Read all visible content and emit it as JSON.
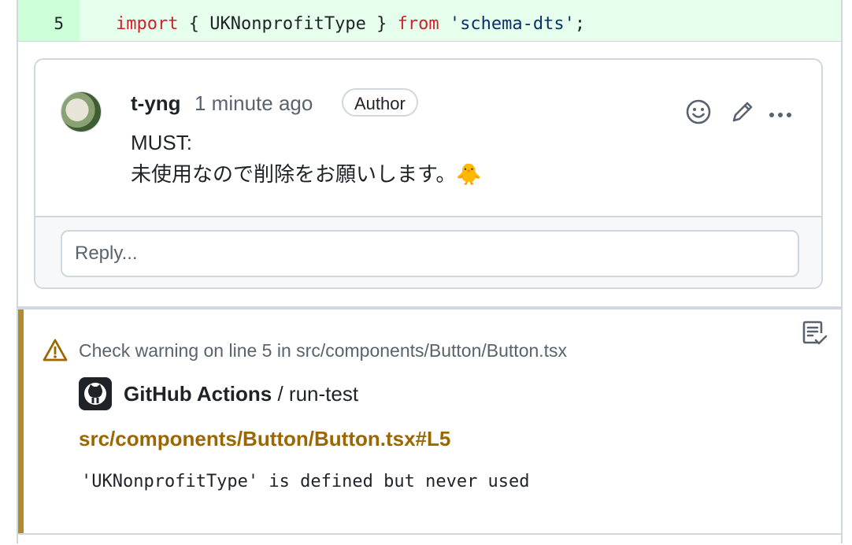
{
  "diff": {
    "line_number": "5",
    "code_keyword_import": "import",
    "code_middle": " { UKNonprofitType } ",
    "code_keyword_from": "from",
    "code_space": " ",
    "code_string": "'schema-dts'",
    "code_end": ";"
  },
  "comment": {
    "author": "t-yng",
    "time": "1 minute ago",
    "badge": "Author",
    "body_line1": "MUST:",
    "body_line2": "未使用なので削除をお願いします。🐥",
    "reply_placeholder": "Reply..."
  },
  "annotation": {
    "title": "Check warning on line 5 in src/components/Button/Button.tsx",
    "app_name": "GitHub Actions",
    "app_suffix": " / run-test",
    "file_link": "src/components/Button/Button.tsx#L5",
    "message": "'UKNonprofitType' is defined but never used",
    "accent_color": "#b08a2c"
  },
  "icons": {
    "emoji_reaction": "smiley-icon",
    "edit": "pencil-icon",
    "more": "kebab-horizontal-icon",
    "warning": "alert-triangle-icon",
    "copy": "copy-checklist-icon",
    "github": "github-logo-icon"
  }
}
